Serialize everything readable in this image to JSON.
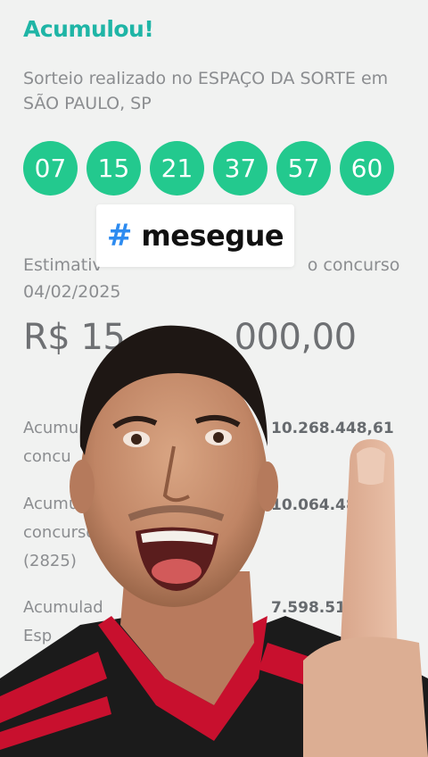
{
  "result": {
    "title": "Acumulou!",
    "subtitle": "Sorteio realizado no ESPAÇO DA SORTE em SÃO PAULO, SP",
    "numbers": [
      "07",
      "15",
      "21",
      "37",
      "57",
      "60"
    ]
  },
  "estimate": {
    "label_visible": "Estimativ",
    "label_tail": "o concurso",
    "date": "04/02/2025",
    "value": "R$ 15,",
    "value_tail": "000,00"
  },
  "accumulated": [
    {
      "label_1": "Acumu",
      "label_2": "concu",
      "label_3": "",
      "value": "10.268.448,61"
    },
    {
      "label_1": "Acumu",
      "label_2": "concurso",
      "label_3": "(2825)",
      "value": "10.064.48"
    },
    {
      "label_1": "Acumulad",
      "label_2": "Esp",
      "label_3": "",
      "value": "7.598.513"
    }
  ],
  "overlay": {
    "hashtag_icon": "#",
    "hashtag_text": "mesegue"
  },
  "colors": {
    "accent": "#1fb5a6",
    "ball": "#23c98e",
    "hashtag": "#2d8bf0",
    "shirt_red": "#c8102e",
    "shirt_black": "#1b1b1b"
  }
}
